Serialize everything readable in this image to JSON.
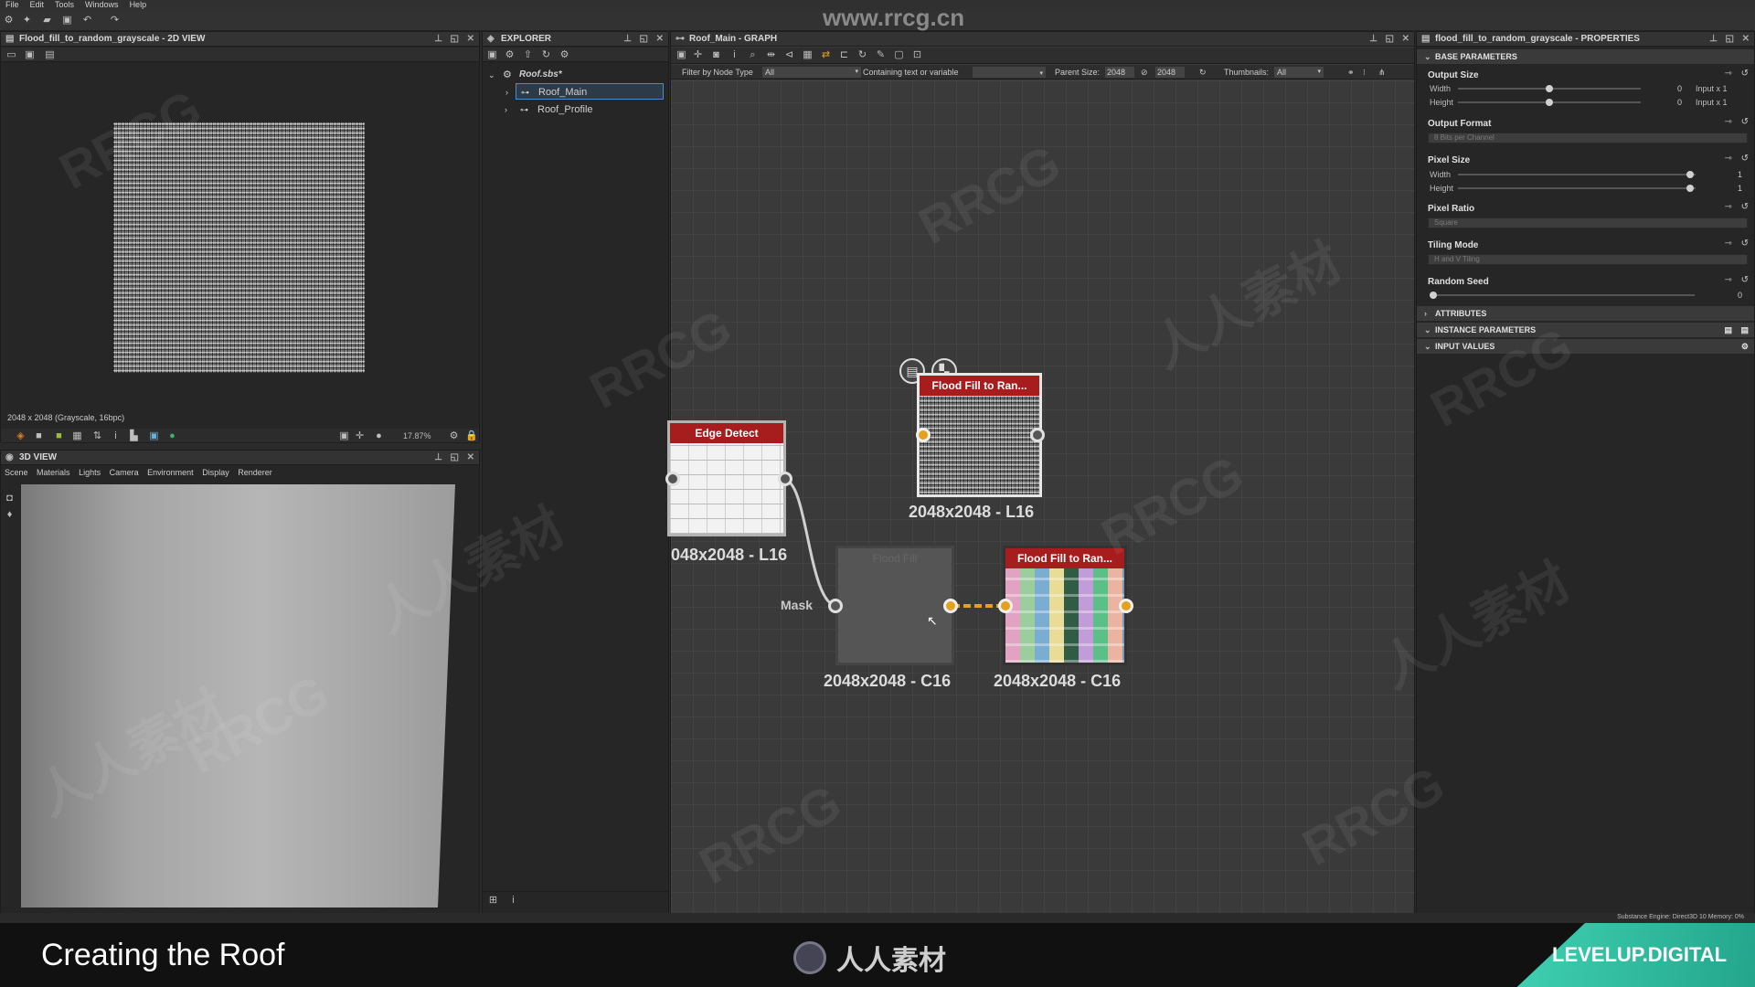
{
  "menu": [
    "File",
    "Edit",
    "Tools",
    "Windows",
    "Help"
  ],
  "watermark": {
    "url": "www.rrcg.cn",
    "brand": "RRCG",
    "cn": "人人素材"
  },
  "view2d": {
    "title": "Flood_fill_to_random_grayscale - 2D VIEW",
    "info": "2048 x 2048 (Grayscale, 16bpc)",
    "zoom": "17.87%"
  },
  "view3d": {
    "title": "3D VIEW",
    "menu": [
      "Scene",
      "Materials",
      "Lights",
      "Camera",
      "Environment",
      "Display",
      "Renderer"
    ]
  },
  "explorer": {
    "title": "EXPLORER",
    "package": "Roof.sbs*",
    "items": [
      "Roof_Main",
      "Roof_Profile"
    ]
  },
  "graph": {
    "title": "Roof_Main - GRAPH",
    "filter_label": "Filter by Node Type",
    "filter_value": "All",
    "containing_label": "Containing text or variable",
    "parent_size_label": "Parent Size:",
    "parent_w": "2048",
    "parent_h": "2048",
    "thumbnails_label": "Thumbnails:",
    "thumbnails_value": "All",
    "nodes": {
      "edge_detect": {
        "title": "Edge Detect",
        "label": "048x2048 - L16"
      },
      "flood_top": {
        "title": "Flood Fill to Ran...",
        "label": "2048x2048 - L16"
      },
      "flood_fill": {
        "title": "Flood Fill",
        "label": "2048x2048 - C16",
        "mask": "Mask"
      },
      "flood_color": {
        "title": "Flood Fill to Ran...",
        "label": "2048x2048 - C16"
      }
    }
  },
  "properties": {
    "title": "flood_fill_to_random_grayscale - PROPERTIES",
    "base": "BASE PARAMETERS",
    "output_size": {
      "label": "Output Size",
      "width": "Width",
      "height": "Height",
      "w_val": "0",
      "h_val": "0",
      "w_rel": "Input x 1",
      "h_rel": "Input x 1"
    },
    "output_format": {
      "label": "Output Format",
      "value": "8 Bits per Channel"
    },
    "pixel_size": {
      "label": "Pixel Size",
      "width": "Width",
      "height": "Height",
      "w_val": "1",
      "h_val": "1"
    },
    "pixel_ratio": {
      "label": "Pixel Ratio",
      "value": "Square"
    },
    "tiling": {
      "label": "Tiling Mode",
      "value": "H and V Tiling"
    },
    "seed": {
      "label": "Random Seed",
      "value": "0"
    },
    "sections": [
      "ATTRIBUTES",
      "INSTANCE PARAMETERS",
      "INPUT VALUES"
    ]
  },
  "status": "Substance Engine: Direct3D 10  Memory: 0%",
  "caption": {
    "title": "Creating the Roof",
    "center": "人人素材",
    "brand": "LEVELUP.DIGITAL"
  }
}
